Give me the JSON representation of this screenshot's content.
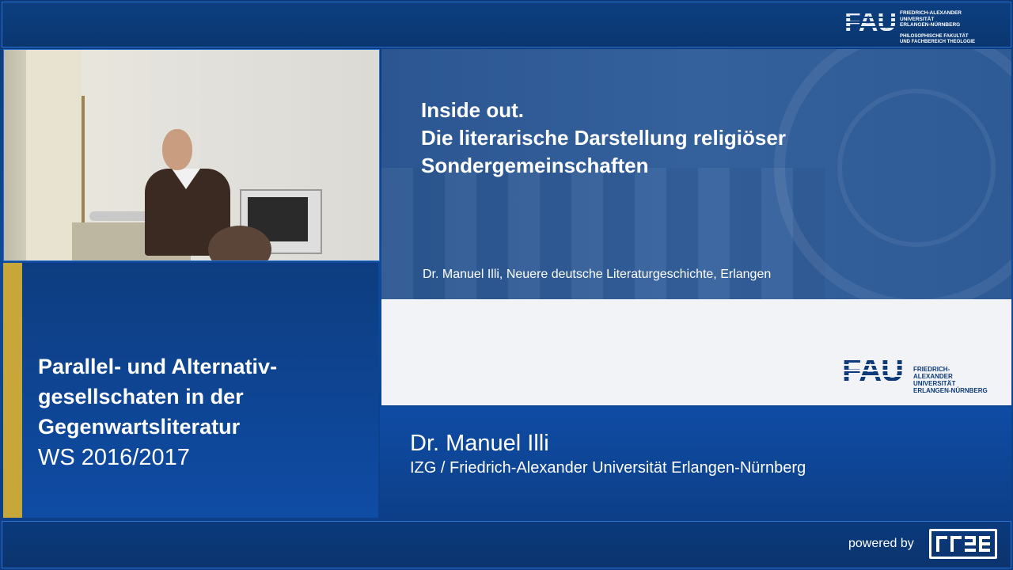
{
  "header": {
    "logo_text": "FAU",
    "logo_lines": "FRIEDRICH-ALEXANDER\nUNIVERSITÄT\nERLANGEN-NÜRNBERG",
    "faculty_lines": "PHILOSOPHISCHE FAKULTÄT\nUND FACHBEREICH THEOLOGIE"
  },
  "slide": {
    "title_line1": "Inside out.",
    "title_line2": "Die literarische Darstellung religiöser",
    "title_line3": "Sondergemeinschaften",
    "author": "Dr. Manuel Illi, Neuere deutsche Literaturgeschichte, Erlangen",
    "logo_text": "FAU",
    "logo_lines": "FRIEDRICH-ALEXANDER\nUNIVERSITÄT\nERLANGEN-NÜRNBERG"
  },
  "course": {
    "title_line1": "Parallel- und Alternativ-",
    "title_line2": "gesellschaten in der",
    "title_line3": "Gegenwartsliteratur",
    "term": "WS 2016/2017"
  },
  "speaker": {
    "name": "Dr. Manuel Illi",
    "institution": "IZG / Friedrich-Alexander Universität Erlangen-Nürnberg"
  },
  "footer": {
    "powered_by": "powered by",
    "logo_icon": "rrze-logo-icon"
  },
  "colors": {
    "background": "#0d3f86",
    "accent_gold": "#c7a63a",
    "slide_blue": "#2e5a96",
    "text": "#ffffff"
  }
}
